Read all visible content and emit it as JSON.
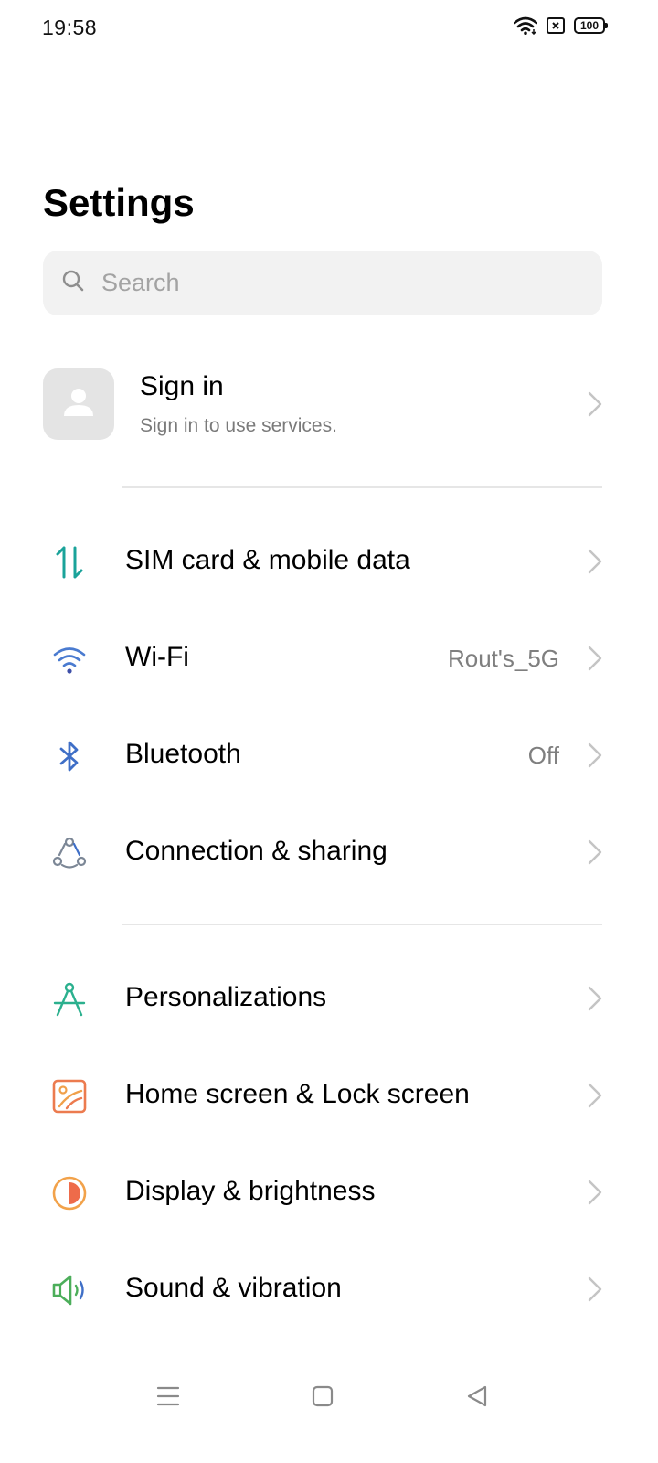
{
  "status_bar": {
    "time": "19:58",
    "battery": "100",
    "icons": [
      "wifi-icon",
      "sim-absent-icon",
      "battery-icon"
    ]
  },
  "title": "Settings",
  "search": {
    "placeholder": "Search",
    "value": ""
  },
  "account": {
    "title": "Sign in",
    "subtitle": "Sign in to use services.",
    "icon": "avatar-person-icon"
  },
  "groups": [
    {
      "items": [
        {
          "label": "SIM card & mobile data",
          "value": "",
          "icon": "mobile-data-icon",
          "color": "#1aa39a"
        },
        {
          "label": "Wi-Fi",
          "value": "Rout's_5G",
          "icon": "wifi-icon",
          "color": "#4a7bd0"
        },
        {
          "label": "Bluetooth",
          "value": "Off",
          "icon": "bluetooth-icon",
          "color": "#3f6fc7"
        },
        {
          "label": "Connection & sharing",
          "value": "",
          "icon": "connection-sharing-icon",
          "color": "#7c8796"
        }
      ]
    },
    {
      "items": [
        {
          "label": "Personalizations",
          "value": "",
          "icon": "compass-icon",
          "color": "#2bb08e"
        },
        {
          "label": "Home screen & Lock screen",
          "value": "",
          "icon": "home-screen-icon",
          "color": "#ec7b4f"
        },
        {
          "label": "Display & brightness",
          "value": "",
          "icon": "brightness-icon",
          "color": "#f2a24a"
        },
        {
          "label": "Sound & vibration",
          "value": "",
          "icon": "speaker-icon",
          "color": "#4cae5a"
        }
      ]
    }
  ],
  "nav_bar": {
    "buttons": [
      "menu-icon",
      "home-icon",
      "back-icon"
    ]
  }
}
